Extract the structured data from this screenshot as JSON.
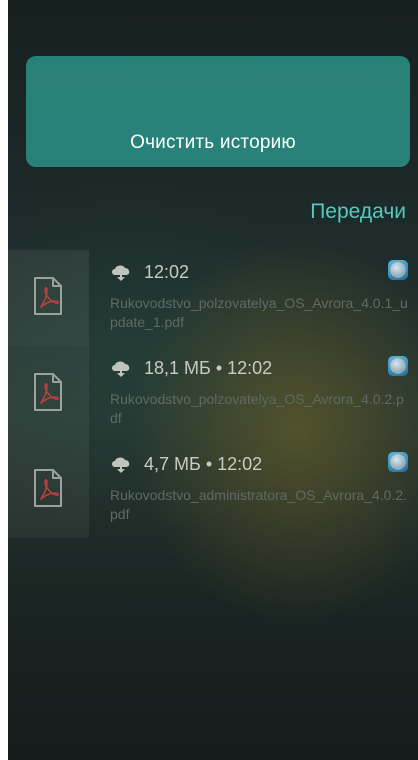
{
  "pulley": {
    "clear_history_label": "Очистить историю"
  },
  "page": {
    "title": "Передачи"
  },
  "transfers": [
    {
      "status": "12:02",
      "filename": "Rukovodstvo_polzovatelya_OS_Avrora_4.0.1_update_1.pdf",
      "file_icon": "pdf-file-icon",
      "status_icon": "download-cloud-icon",
      "app_icon": "browser-globe-icon"
    },
    {
      "status": "18,1 МБ • 12:02",
      "filename": "Rukovodstvo_polzovatelya_OS_Avrora_4.0.2.pdf",
      "file_icon": "pdf-file-icon",
      "status_icon": "download-cloud-icon",
      "app_icon": "browser-globe-icon"
    },
    {
      "status": "4,7 МБ • 12:02",
      "filename": "Rukovodstvo_administratora_OS_Avrora_4.0.2.pdf",
      "file_icon": "pdf-file-icon",
      "status_icon": "download-cloud-icon",
      "app_icon": "browser-globe-icon"
    }
  ],
  "colors": {
    "accent": "#56c8c0",
    "pulley_bg": "#2a8a80",
    "primary_text": "#c8ccc4",
    "secondary_text": "#5f6a64"
  }
}
